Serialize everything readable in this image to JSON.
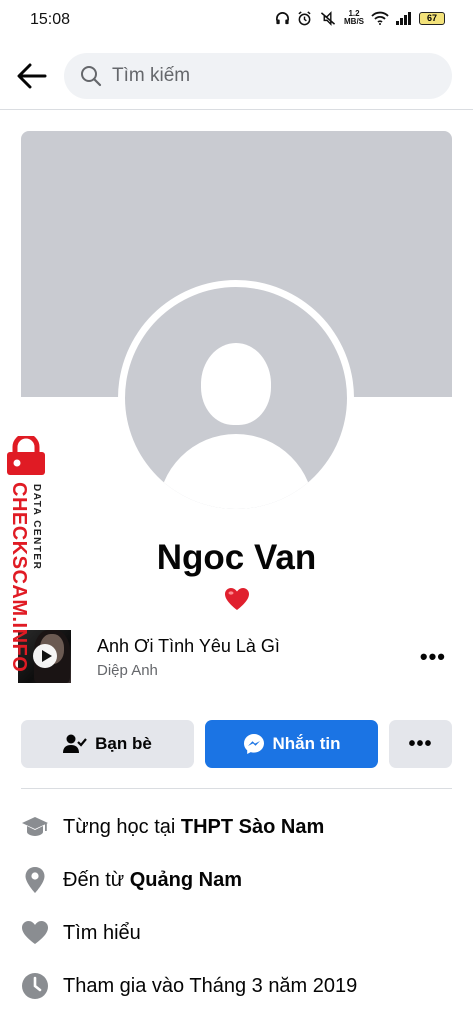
{
  "status_bar": {
    "time": "15:08",
    "net_speed_value": "1.2",
    "net_speed_unit": "MB/S",
    "battery": "67"
  },
  "search": {
    "placeholder": "Tìm kiếm"
  },
  "profile": {
    "name": "Ngoc Van",
    "bio_emoji": "heart"
  },
  "music": {
    "title": "Anh Ơi Tình Yêu Là Gì",
    "artist": "Diệp Anh",
    "more": "•••"
  },
  "actions": {
    "friends_label": "Bạn bè",
    "message_label": "Nhắn tin",
    "more_label": "•••"
  },
  "info": [
    {
      "prefix": "Từng học tại ",
      "strong": "THPT Sào Nam",
      "icon": "graduation-cap-icon"
    },
    {
      "prefix": "Đến từ ",
      "strong": "Quảng Nam",
      "icon": "location-pin-icon"
    },
    {
      "prefix": "Tìm hiểu",
      "strong": "",
      "icon": "heart-icon"
    },
    {
      "prefix": "Tham gia vào Tháng 3 năm 2019",
      "strong": "",
      "icon": "clock-icon"
    }
  ],
  "watermark": {
    "main": "CHECKSCAM.INFO",
    "sub": "DATA CENTER"
  },
  "colors": {
    "accent": "#1b74e4",
    "cover": "#c9cbd1",
    "watermark": "#e01b24"
  }
}
